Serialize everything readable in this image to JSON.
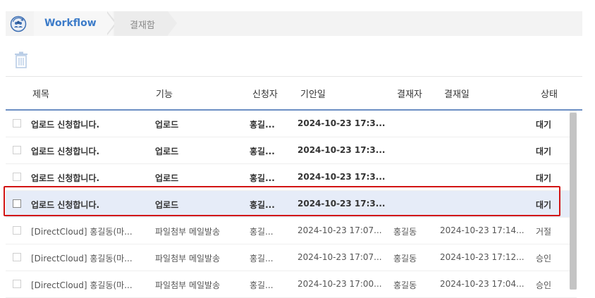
{
  "breadcrumb": {
    "home_icon": "workflow-home-icon",
    "workflow_label": "Workflow",
    "current_label": "결재함"
  },
  "toolbar": {
    "delete_icon": "trash-icon"
  },
  "table": {
    "headers": {
      "title": "제목",
      "function": "기능",
      "applicant": "신청자",
      "draft_date": "기안일",
      "approver": "결재자",
      "approval_date": "결재일",
      "status": "상태"
    },
    "rows": [
      {
        "title": "업로드 신청합니다.",
        "function": "업로드",
        "applicant": "홍길...",
        "draft_date": "2024-10-23 17:3...",
        "approver": "",
        "approval_date": "",
        "status": "대기",
        "bold": true,
        "selected": false
      },
      {
        "title": "업로드 신청합니다.",
        "function": "업로드",
        "applicant": "홍길...",
        "draft_date": "2024-10-23 17:3...",
        "approver": "",
        "approval_date": "",
        "status": "대기",
        "bold": true,
        "selected": false
      },
      {
        "title": "업로드 신청합니다.",
        "function": "업로드",
        "applicant": "홍길...",
        "draft_date": "2024-10-23 17:3...",
        "approver": "",
        "approval_date": "",
        "status": "대기",
        "bold": true,
        "selected": false
      },
      {
        "title": "업로드 신청합니다.",
        "function": "업로드",
        "applicant": "홍길...",
        "draft_date": "2024-10-23 17:3...",
        "approver": "",
        "approval_date": "",
        "status": "대기",
        "bold": true,
        "selected": true
      },
      {
        "title": "[DirectCloud] 홍길동(마...",
        "function": "파일첨부 메일발송",
        "applicant": "홍길...",
        "draft_date": "2024-10-23 17:07...",
        "approver": "홍길동",
        "approval_date": "2024-10-23 17:14...",
        "status": "거절",
        "bold": false,
        "selected": false
      },
      {
        "title": "[DirectCloud] 홍길동(마...",
        "function": "파일첨부 메일발송",
        "applicant": "홍길...",
        "draft_date": "2024-10-23 17:07...",
        "approver": "홍길동",
        "approval_date": "2024-10-23 17:12...",
        "status": "승인",
        "bold": false,
        "selected": false
      },
      {
        "title": "[DirectCloud] 홍길동(마...",
        "function": "파일첨부 메일발송",
        "applicant": "홍길...",
        "draft_date": "2024-10-23 17:00...",
        "approver": "홍길동",
        "approval_date": "2024-10-23 17:04...",
        "status": "승인",
        "bold": false,
        "selected": false
      }
    ]
  },
  "colors": {
    "accent": "#3d7cc9",
    "highlight": "#d21414",
    "selected_row": "#e6ecf8"
  }
}
